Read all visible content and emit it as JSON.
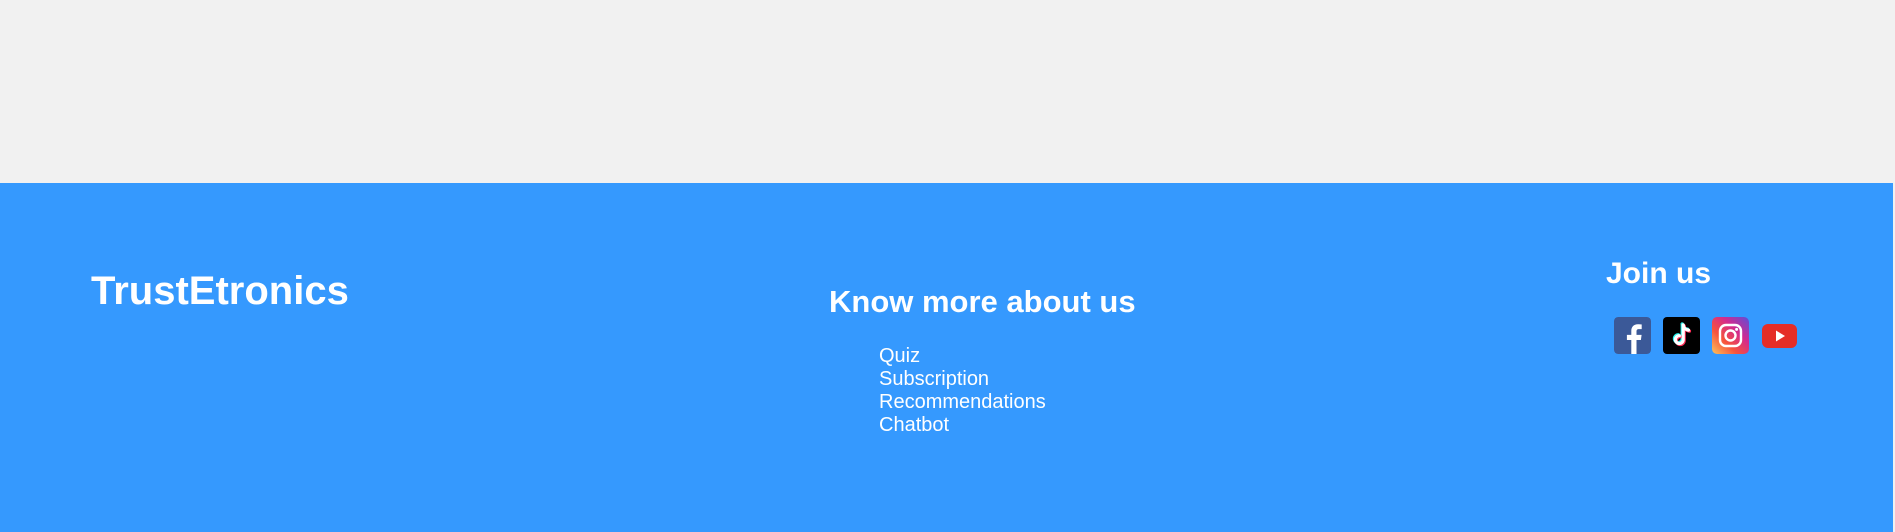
{
  "brand": {
    "name": "TrustEtronics"
  },
  "about": {
    "heading": "Know more about us",
    "links": [
      {
        "label": "Quiz"
      },
      {
        "label": "Subscription"
      },
      {
        "label": "Recommendations"
      },
      {
        "label": "Chatbot"
      }
    ]
  },
  "join": {
    "heading": "Join us",
    "social": [
      {
        "icon": "facebook-icon",
        "color": "#3b5998"
      },
      {
        "icon": "tiktok-icon",
        "color": "#000000"
      },
      {
        "icon": "instagram-icon",
        "color": "#c13584"
      },
      {
        "icon": "youtube-icon",
        "color": "#e52d27"
      }
    ]
  },
  "colors": {
    "footer_background": "#3599fe",
    "page_background": "#f1f1f1",
    "text": "#ffffff"
  }
}
